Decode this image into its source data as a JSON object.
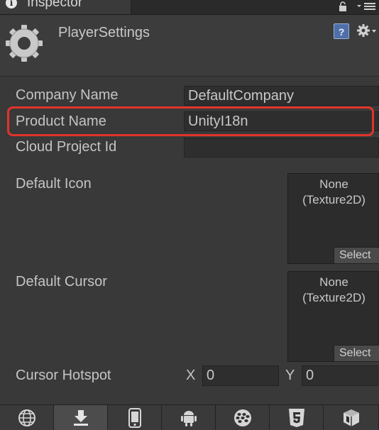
{
  "tab": {
    "title": "Inspector"
  },
  "header": {
    "title": "PlayerSettings",
    "help_glyph": "?"
  },
  "rows": {
    "company_name": {
      "label": "Company Name",
      "value": "DefaultCompany"
    },
    "product_name": {
      "label": "Product Name",
      "value": "UnityI18n"
    },
    "cloud_project_id": {
      "label": "Cloud Project Id",
      "value": ""
    }
  },
  "default_icon": {
    "label": "Default Icon",
    "texture": "None\n(Texture2D)",
    "select_label": "Select"
  },
  "default_cursor": {
    "label": "Default Cursor",
    "texture": "None\n(Texture2D)",
    "select_label": "Select"
  },
  "cursor_hotspot": {
    "label": "Cursor Hotspot",
    "x_label": "X",
    "x_value": "0",
    "y_label": "Y",
    "y_value": "0"
  },
  "platforms": [
    {
      "icon": "globe-icon",
      "active": false
    },
    {
      "icon": "download-icon",
      "active": true
    },
    {
      "icon": "phone-icon",
      "active": false
    },
    {
      "icon": "android-icon",
      "active": false
    },
    {
      "icon": "blackberry-icon",
      "active": false
    },
    {
      "icon": "html5-icon",
      "active": false
    },
    {
      "icon": "package-icon",
      "active": false
    }
  ],
  "colors": {
    "highlight": "#e0342b",
    "accent": "#4e6fa8"
  }
}
